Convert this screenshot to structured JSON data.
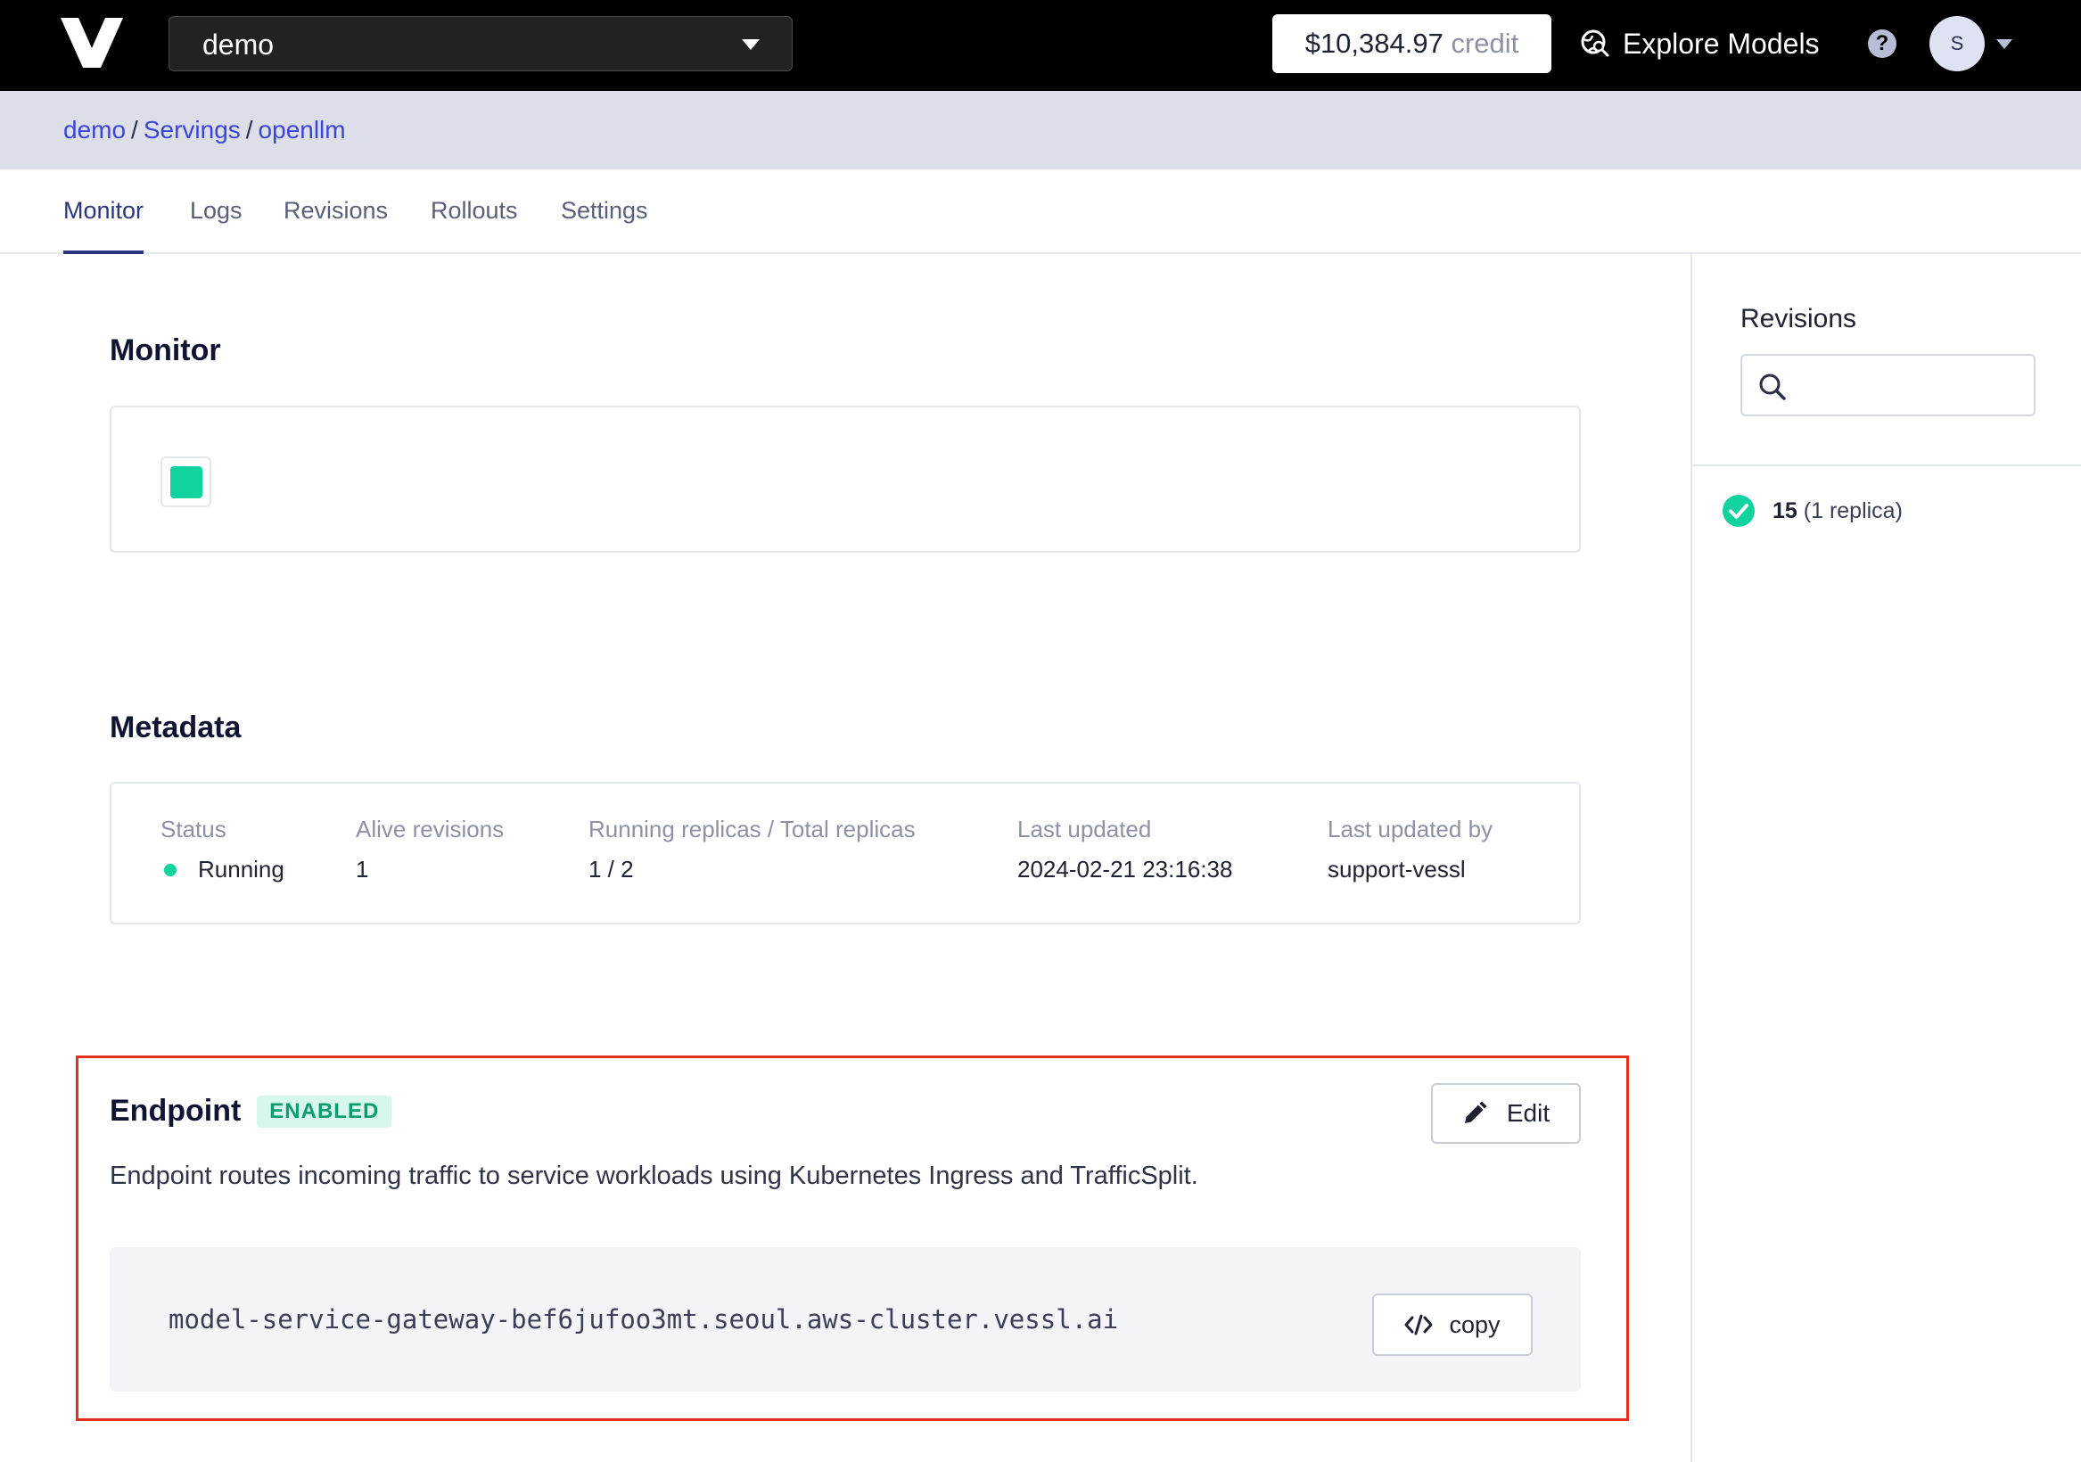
{
  "topbar": {
    "project": "demo",
    "credit_amount": "$10,384.97",
    "credit_unit": "credit",
    "explore_label": "Explore Models",
    "help_glyph": "?",
    "avatar_initial": "S"
  },
  "breadcrumb": [
    "demo",
    "Servings",
    "openllm"
  ],
  "tabs": [
    "Monitor",
    "Logs",
    "Revisions",
    "Rollouts",
    "Settings"
  ],
  "active_tab": "Monitor",
  "monitor": {
    "title": "Monitor",
    "chip_color": "#10d39e"
  },
  "metadata": {
    "title": "Metadata",
    "status_label": "Status",
    "status_value": "Running",
    "alive_label": "Alive revisions",
    "alive_value": "1",
    "replicas_label": "Running replicas / Total replicas",
    "replicas_value": "1 / 2",
    "updated_label": "Last updated",
    "updated_value": "2024-02-21 23:16:38",
    "updated_by_label": "Last updated by",
    "updated_by_value": "support-vessl"
  },
  "endpoint": {
    "title": "Endpoint",
    "badge": "ENABLED",
    "edit_label": "Edit",
    "description": "Endpoint routes incoming traffic to service workloads using Kubernetes Ingress and TrafficSplit.",
    "url": "model-service-gateway-bef6jufoo3mt.seoul.aws-cluster.vessl.ai",
    "copy_label": "copy"
  },
  "sidebar": {
    "title": "Revisions",
    "search_placeholder": "",
    "revisions": [
      {
        "number": "15",
        "detail": "(1 replica)"
      }
    ]
  },
  "colors": {
    "accent": "#3b45d6",
    "active_tab": "#2b3580",
    "success": "#10d39e",
    "highlight_border": "#e0301e"
  }
}
